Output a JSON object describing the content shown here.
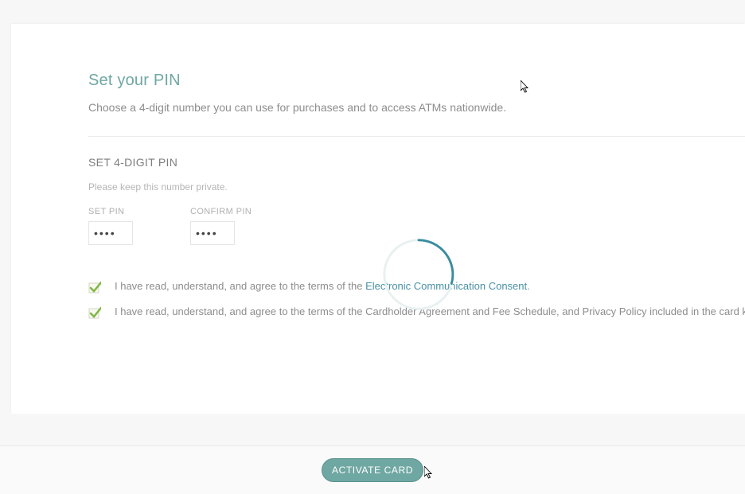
{
  "header": {
    "title": "Set your PIN",
    "subtitle": "Choose a 4-digit number you can use for purchases and to access ATMs nationwide."
  },
  "pin_section": {
    "heading": "SET 4-DIGIT PIN",
    "note": "Please keep this number private.",
    "set_label": "SET PIN",
    "confirm_label": "CONFIRM PIN",
    "set_value": "••••",
    "confirm_value": "••••"
  },
  "consents": {
    "row1_prefix": "I have read, understand, and agree to the terms of the ",
    "row1_link": "Electronic Communication Consent",
    "row1_suffix": ".",
    "row2_text": "I have read, understand, and agree to the terms of the Cardholder Agreement and Fee Schedule, and Privacy Policy included in the card kit."
  },
  "footer": {
    "activate_label": "ACTIVATE CARD"
  },
  "colors": {
    "accent": "#6fa7a2",
    "link": "#4a90a4"
  }
}
